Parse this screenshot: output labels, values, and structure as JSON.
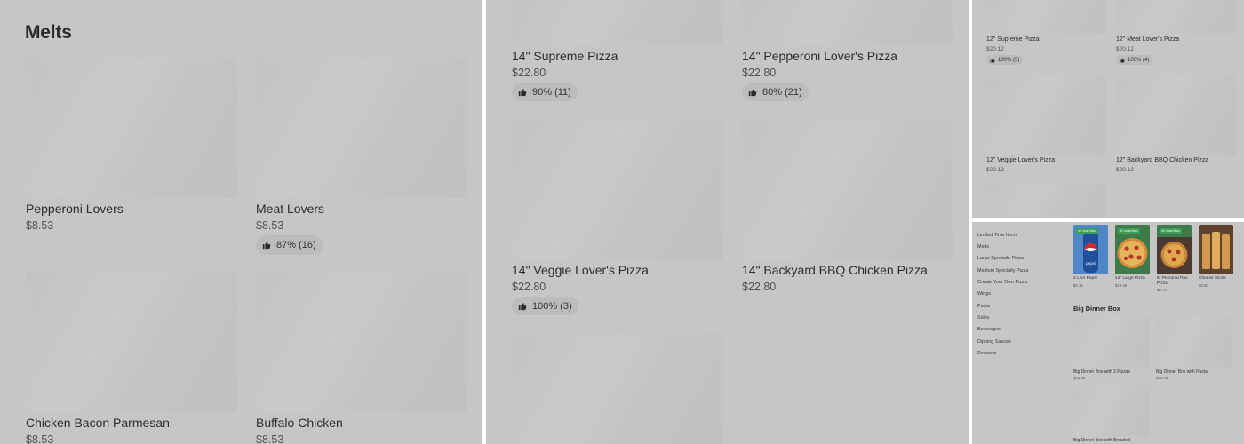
{
  "panel1": {
    "section_title": "Melts",
    "items": [
      {
        "name": "Pepperoni Lovers",
        "price": "$8.53"
      },
      {
        "name": "Meat Lovers",
        "price": "$8.53",
        "rating": "87% (16)"
      },
      {
        "name": "Chicken Bacon Parmesan",
        "price": "$8.53"
      },
      {
        "name": "Buffalo Chicken",
        "price": "$8.53"
      }
    ]
  },
  "panel2": {
    "items": [
      {
        "name": "14\" Supreme Pizza",
        "price": "$22.80",
        "rating": "90% (11)"
      },
      {
        "name": "14\" Pepperoni Lover's Pizza",
        "price": "$22.80",
        "rating": "80% (21)"
      },
      {
        "name": "14\" Veggie Lover's Pizza",
        "price": "$22.80",
        "rating": "100% (3)"
      },
      {
        "name": "14\" Backyard BBQ Chicken Pizza",
        "price": "$22.80"
      }
    ]
  },
  "panel3": {
    "items": [
      {
        "name": "12\" Supreme Pizza",
        "price": "$20.12",
        "rating": "100% (5)"
      },
      {
        "name": "12\" Meat Lover's Pizza",
        "price": "$20.12",
        "rating": "100% (4)"
      },
      {
        "name": "12\" Veggie Lover's Pizza",
        "price": "$20.12"
      },
      {
        "name": "12\" Backyard BBQ Chicken Pizza",
        "price": "$20.12"
      }
    ]
  },
  "panel4": {
    "nav": [
      "Limited Time Items",
      "Melts",
      "Large Specialty Pizza",
      "Medium Specialty Pizza",
      "Create Your Own Pizza",
      "Wings",
      "Pasta",
      "Sides",
      "Beverages",
      "Dipping Sauces",
      "Desserts"
    ],
    "featured": [
      {
        "name": "2 Liter Pepsi",
        "price": "$4.14",
        "tag": "#1 most liked"
      },
      {
        "name": "14\" Large Pizza",
        "price": "$18.46",
        "tag": "#2 most liked"
      },
      {
        "name": "6\" Personal Pan Pizza",
        "price": "$6.70",
        "tag": "#3 most liked"
      },
      {
        "name": "Cheese Sticks",
        "price": "$9.50"
      }
    ],
    "pepsi_logo_text": "pepsi",
    "section_title": "Big Dinner Box",
    "boxes": [
      {
        "name": "Big Dinner Box with 3 Pizzas",
        "price": "$33.46"
      },
      {
        "name": "Big Dinner Box with Pasta",
        "price": "$33.46"
      },
      {
        "name": "Big Dinner Box with Breaded"
      }
    ]
  },
  "colors": {
    "overlay_gray": "#c6c6c6",
    "placeholder": "#c4c4c4",
    "rating_pill": "#bcbcbc",
    "tag_green": "#3e9b5a"
  }
}
